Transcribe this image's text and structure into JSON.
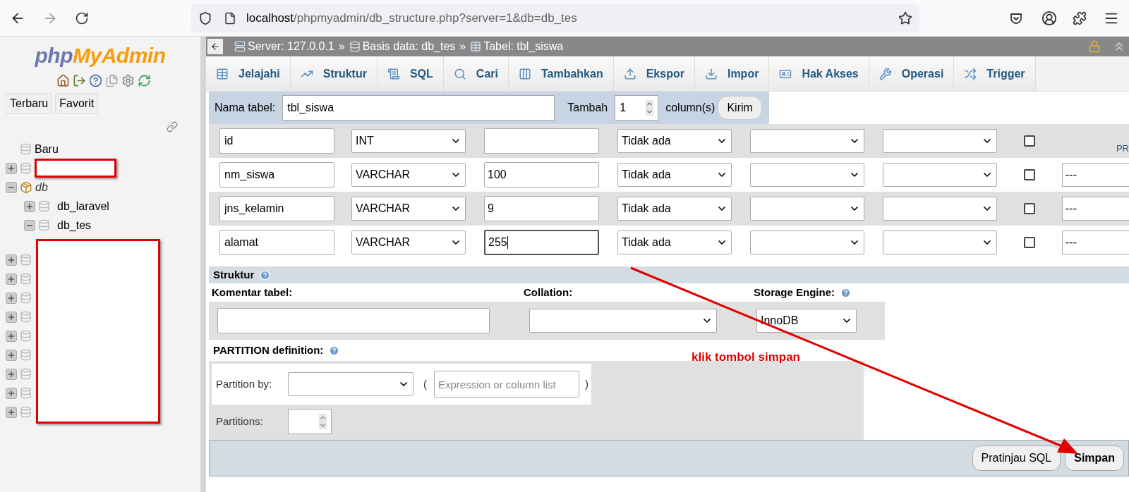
{
  "browser": {
    "url_host": "localhost",
    "url_path": "/phpmyadmin/db_structure.php?server=1&db=db_tes"
  },
  "sidebar": {
    "logo": [
      "php",
      "MyAdmin"
    ],
    "buttons": [
      "Terbaru",
      "Favorit"
    ],
    "tree": [
      {
        "kind": "new",
        "label": "Baru"
      },
      {
        "kind": "hidden",
        "expanded": false
      },
      {
        "kind": "group",
        "label": "db",
        "expanded": true,
        "children": [
          {
            "label": "db_laravel",
            "expanded": false
          },
          {
            "label": "db_tes",
            "expanded": true
          }
        ]
      },
      {
        "kind": "hidden",
        "expanded": false
      },
      {
        "kind": "hidden",
        "expanded": false
      },
      {
        "kind": "hidden",
        "expanded": false
      },
      {
        "kind": "hidden",
        "expanded": false
      },
      {
        "kind": "hidden",
        "expanded": false
      },
      {
        "kind": "hidden",
        "expanded": false
      },
      {
        "kind": "hidden",
        "expanded": false
      },
      {
        "kind": "hidden",
        "expanded": false
      },
      {
        "kind": "hidden",
        "expanded": false
      }
    ]
  },
  "breadcrumb": [
    {
      "kind": "server",
      "text": "Server: 127.0.0.1"
    },
    {
      "kind": "database",
      "text": "Basis data: db_tes"
    },
    {
      "kind": "table",
      "text": "Tabel: tbl_siswa"
    }
  ],
  "breadcrumb_separators": [
    "»",
    "»"
  ],
  "tabs": [
    {
      "label": "Jelajahi",
      "kind": "browse",
      "selected": false
    },
    {
      "label": "Struktur",
      "kind": "structure",
      "selected": false
    },
    {
      "label": "SQL",
      "kind": "sql",
      "selected": false
    },
    {
      "label": "Cari",
      "kind": "search",
      "selected": false
    },
    {
      "label": "Tambahkan",
      "kind": "insert",
      "selected": false
    },
    {
      "label": "Ekspor",
      "kind": "export",
      "selected": false
    },
    {
      "label": "Impor",
      "kind": "import",
      "selected": false
    },
    {
      "label": "Hak Akses",
      "kind": "privileges",
      "selected": false
    },
    {
      "label": "Operasi",
      "kind": "operations",
      "selected": false
    },
    {
      "label": "Trigger",
      "kind": "triggers",
      "selected": false
    }
  ],
  "table_name_bar": {
    "label": "Nama tabel:",
    "value": "tbl_siswa",
    "add_label": "Tambah",
    "add_value": "1",
    "add_suffix": "column(s)",
    "button": "Kirim"
  },
  "columns": [
    {
      "name": "id",
      "type": "INT",
      "default": "Tidak ada",
      "null": false,
      "focused": false,
      "link": "PR"
    },
    {
      "name": "nm_siswa",
      "type": "VARCHAR",
      "length": "100",
      "default": "Tidak ada",
      "null": false,
      "focused": false,
      "index": "---"
    },
    {
      "name": "jns_kelamin",
      "type": "VARCHAR",
      "length": "9",
      "default": "Tidak ada",
      "null": false,
      "focused": false,
      "index": "---"
    },
    {
      "name": "alamat",
      "type": "VARCHAR",
      "length": "255",
      "default": "Tidak ada",
      "null": false,
      "focused": true,
      "index": "---"
    }
  ],
  "structure": {
    "title": "Struktur",
    "comment_label": "Komentar tabel:",
    "collation_label": "Collation:",
    "engine_label": "Storage Engine:",
    "engine": "InnoDB"
  },
  "partition": {
    "title": "PARTITION definition:",
    "by_label": "Partition by:",
    "open_paren": "(",
    "expression_placeholder": "Expression or column list",
    "close_paren": ")",
    "count_label": "Partitions:"
  },
  "footer_buttons": [
    {
      "label": "Pratinjau SQL",
      "primary": false
    },
    {
      "label": "Simpan",
      "primary": true
    }
  ],
  "annotation": {
    "text": "klik tombol simpan"
  }
}
